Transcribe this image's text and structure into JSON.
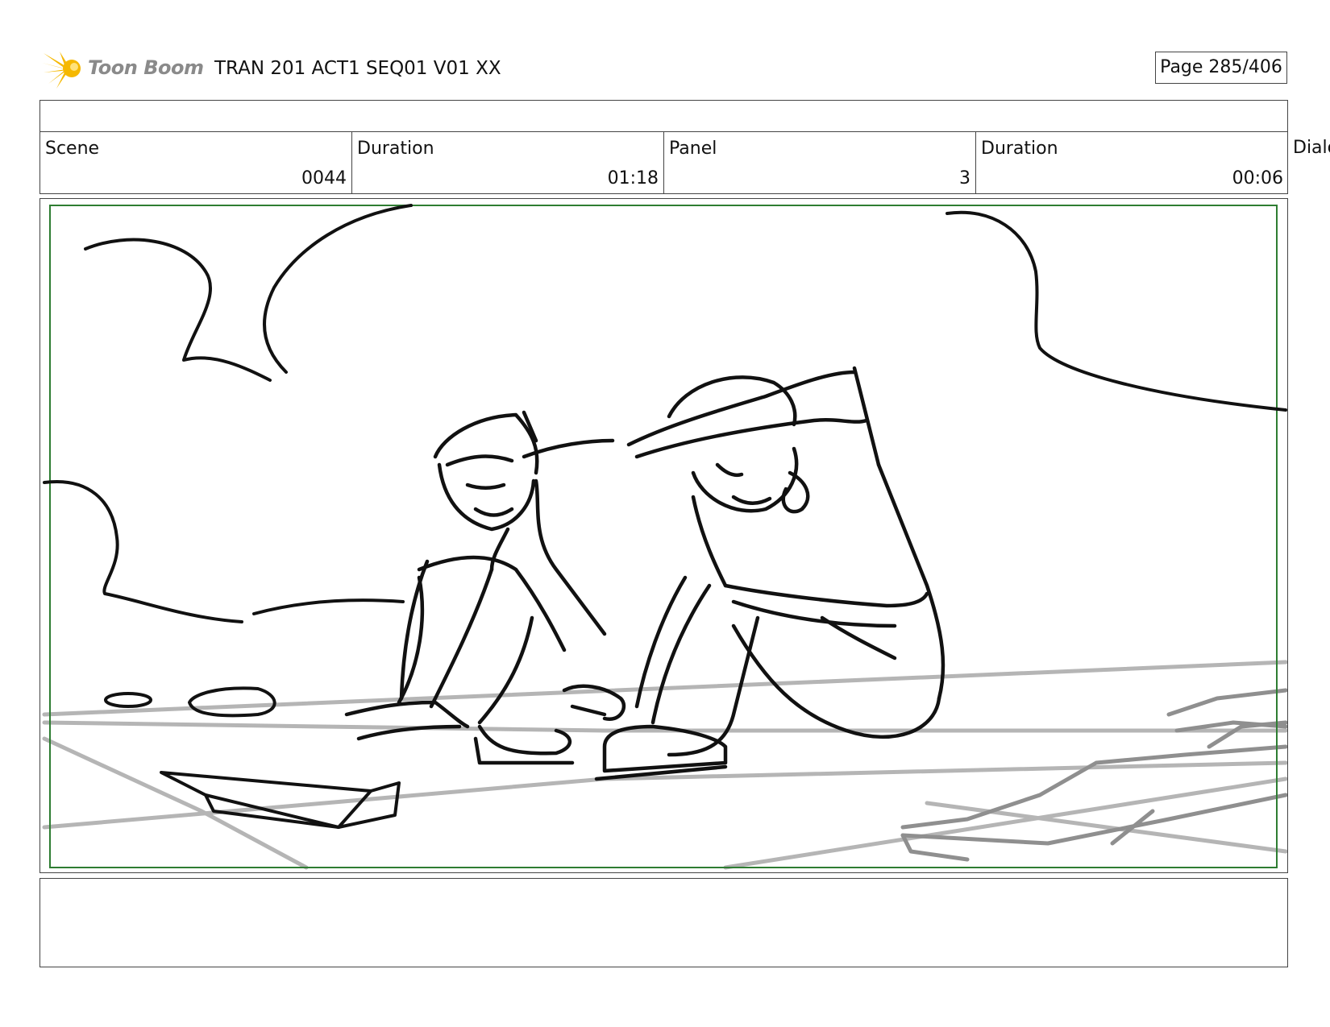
{
  "header": {
    "logo_text": "Toon Boom",
    "title": "TRAN 201 ACT1 SEQ01 V01 XX",
    "page": "Page 285/406"
  },
  "info": {
    "scene_label": "Scene",
    "scene_value": "0044",
    "duration_label": "Duration",
    "duration_value": "01:18",
    "panel_label": "Panel",
    "panel_value": "3",
    "panel_duration_label": "Duration",
    "panel_duration_value": "00:06",
    "dialog_label": "Dialog"
  },
  "colors": {
    "logo_star": "#f5b800",
    "safe_frame": "#2e7d32",
    "sketch_line": "#111111",
    "ground_line": "#9a9a9a"
  },
  "panel_image": "storyboard-sketch-two-people-sitting-on-ground"
}
